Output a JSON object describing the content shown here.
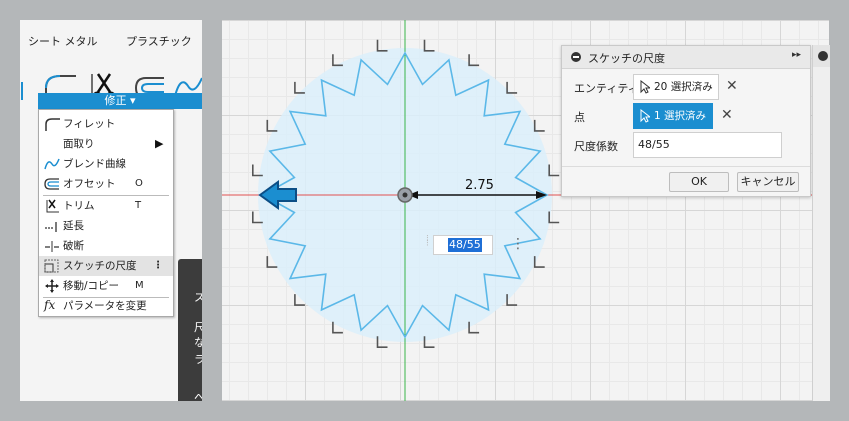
{
  "ribbon": {
    "tabs": [
      "シート メタル",
      "プラスチック"
    ],
    "modify_label": "修正 ▾"
  },
  "modify_menu": {
    "items": [
      {
        "label": "フィレット",
        "shortcut": "",
        "icon": "fillet-icon"
      },
      {
        "label": "面取り",
        "shortcut": "",
        "icon": "chamfer-icon",
        "submenu": "▶"
      },
      {
        "label": "ブレンド曲線",
        "shortcut": "",
        "icon": "blend-curve-icon"
      },
      {
        "label": "オフセット",
        "shortcut": "O",
        "icon": "offset-icon"
      },
      {
        "label": "トリム",
        "shortcut": "T",
        "icon": "trim-icon"
      },
      {
        "label": "延長",
        "shortcut": "",
        "icon": "extend-icon"
      },
      {
        "label": "破断",
        "shortcut": "",
        "icon": "break-icon"
      },
      {
        "label": "スケッチの尺度",
        "shortcut": "⋮",
        "icon": "sketch-scale-icon"
      },
      {
        "label": "移動/コピー",
        "shortcut": "M",
        "icon": "move-copy-icon"
      },
      {
        "label": "パラメータを変更",
        "shortcut": "",
        "icon": "fx-icon"
      }
    ]
  },
  "tooltip_fragment": [
    "ス",
    "尺",
    "な",
    "ラ",
    "へ"
  ],
  "canvas": {
    "dimension_value": "2.75",
    "scale_input_value": "48/55"
  },
  "dialog": {
    "title": "スケッチの尺度",
    "expand_icon": "▸▸",
    "entity_label": "エンティティ",
    "entity_value": "20 選択済み",
    "point_label": "点",
    "point_value": "1 選択済み",
    "factor_label": "尺度係数",
    "factor_value": "48/55",
    "ok_label": "OK",
    "cancel_label": "キャンセル",
    "clear_symbol": "✕"
  },
  "colors": {
    "accent": "#1b8ed0",
    "sketch_line": "#5bb8e8",
    "fill": "#dbeefa",
    "axis_green": "#39b54a",
    "axis_red": "#e05050"
  }
}
